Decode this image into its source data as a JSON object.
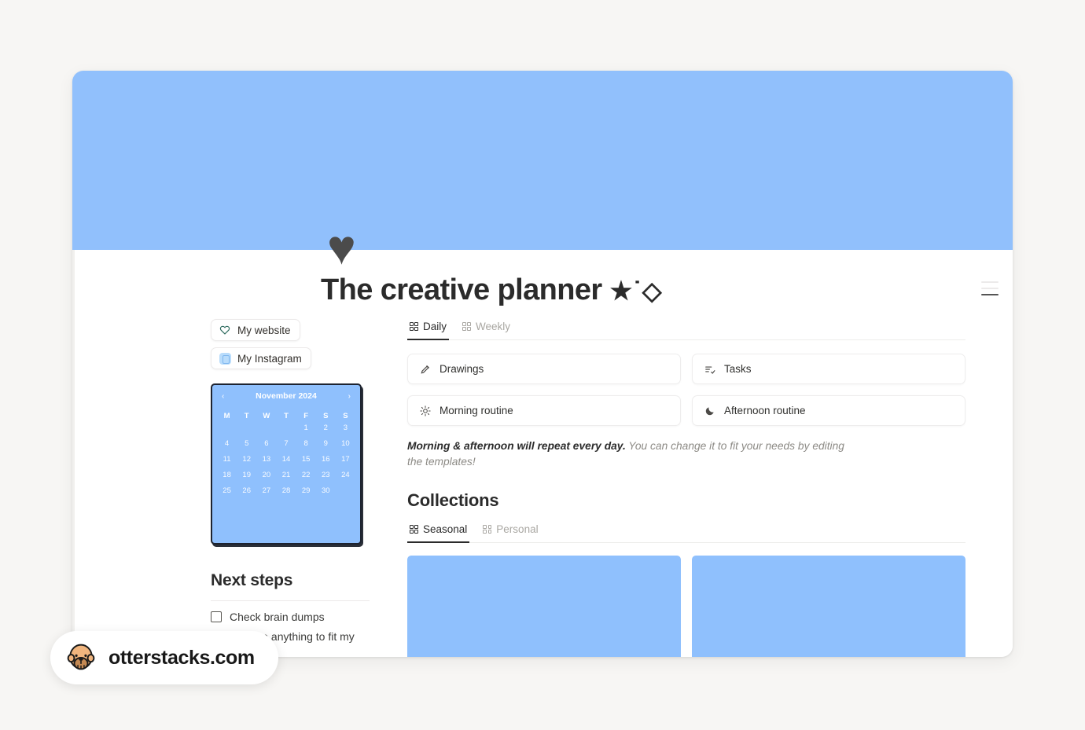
{
  "page": {
    "icon": "♥",
    "icon_name": "heart-icon",
    "title": "The creative planner",
    "title_decoration": "★˙◇",
    "cover_color": "#91c0fc",
    "accent_color": "#8fc0fd"
  },
  "sidebar": {
    "links": [
      {
        "label": "My website",
        "icon": "heart-outline-icon"
      },
      {
        "label": "My Instagram",
        "icon": "instagram-icon"
      }
    ],
    "calendar": {
      "month_label": "November 2024",
      "prev": "‹",
      "next": "›",
      "weekdays": [
        "M",
        "T",
        "W",
        "T",
        "F",
        "S",
        "S"
      ],
      "leading_blanks": 4,
      "days": [
        1,
        2,
        3,
        4,
        5,
        6,
        7,
        8,
        9,
        10,
        11,
        12,
        13,
        14,
        15,
        16,
        17,
        18,
        19,
        20,
        21,
        22,
        23,
        24,
        25,
        26,
        27,
        28,
        29,
        30
      ]
    },
    "next_steps": {
      "heading": "Next steps",
      "items": [
        {
          "label": "Check brain dumps",
          "checked": false
        },
        {
          "label": "Change anything to fit my",
          "checked": false
        }
      ]
    }
  },
  "main": {
    "planner_tabs": [
      {
        "label": "Daily",
        "active": true
      },
      {
        "label": "Weekly",
        "active": false
      }
    ],
    "cards": [
      {
        "label": "Drawings",
        "icon": "pencil-icon"
      },
      {
        "label": "Tasks",
        "icon": "task-list-icon"
      },
      {
        "label": "Morning routine",
        "icon": "sun-icon"
      },
      {
        "label": "Afternoon routine",
        "icon": "moon-icon"
      }
    ],
    "note_bold": "Morning & afternoon will repeat every day.",
    "note_rest": " You can change it to fit your needs by editing the templates!",
    "collections": {
      "heading": "Collections",
      "tabs": [
        {
          "label": "Seasonal",
          "active": true
        },
        {
          "label": "Personal",
          "active": false
        }
      ],
      "cards": [
        {
          "label": ""
        },
        {
          "label": ""
        }
      ]
    }
  },
  "watermark": {
    "text": "otterstacks.com",
    "icon": "otter-logo"
  }
}
